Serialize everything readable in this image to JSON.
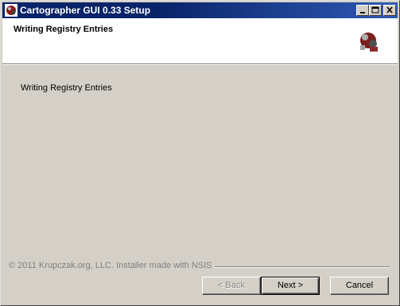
{
  "window": {
    "title": "Cartographer GUI 0.33 Setup",
    "icon": "installer-app-icon",
    "controls": [
      "minimize-icon",
      "maximize-icon",
      "close-icon"
    ]
  },
  "header": {
    "title": "Writing Registry Entries",
    "logo": "installer-logo-icon"
  },
  "main": {
    "status_text": "Writing Registry Entries"
  },
  "footer": {
    "branding": "© 2011 Krupczak.org, LLC.  Installer made with NSIS"
  },
  "buttons": {
    "back": "< Back",
    "next": "Next >",
    "cancel": "Cancel"
  },
  "colors": {
    "titlebar": "#0a246a",
    "face": "#d4d0c8"
  }
}
